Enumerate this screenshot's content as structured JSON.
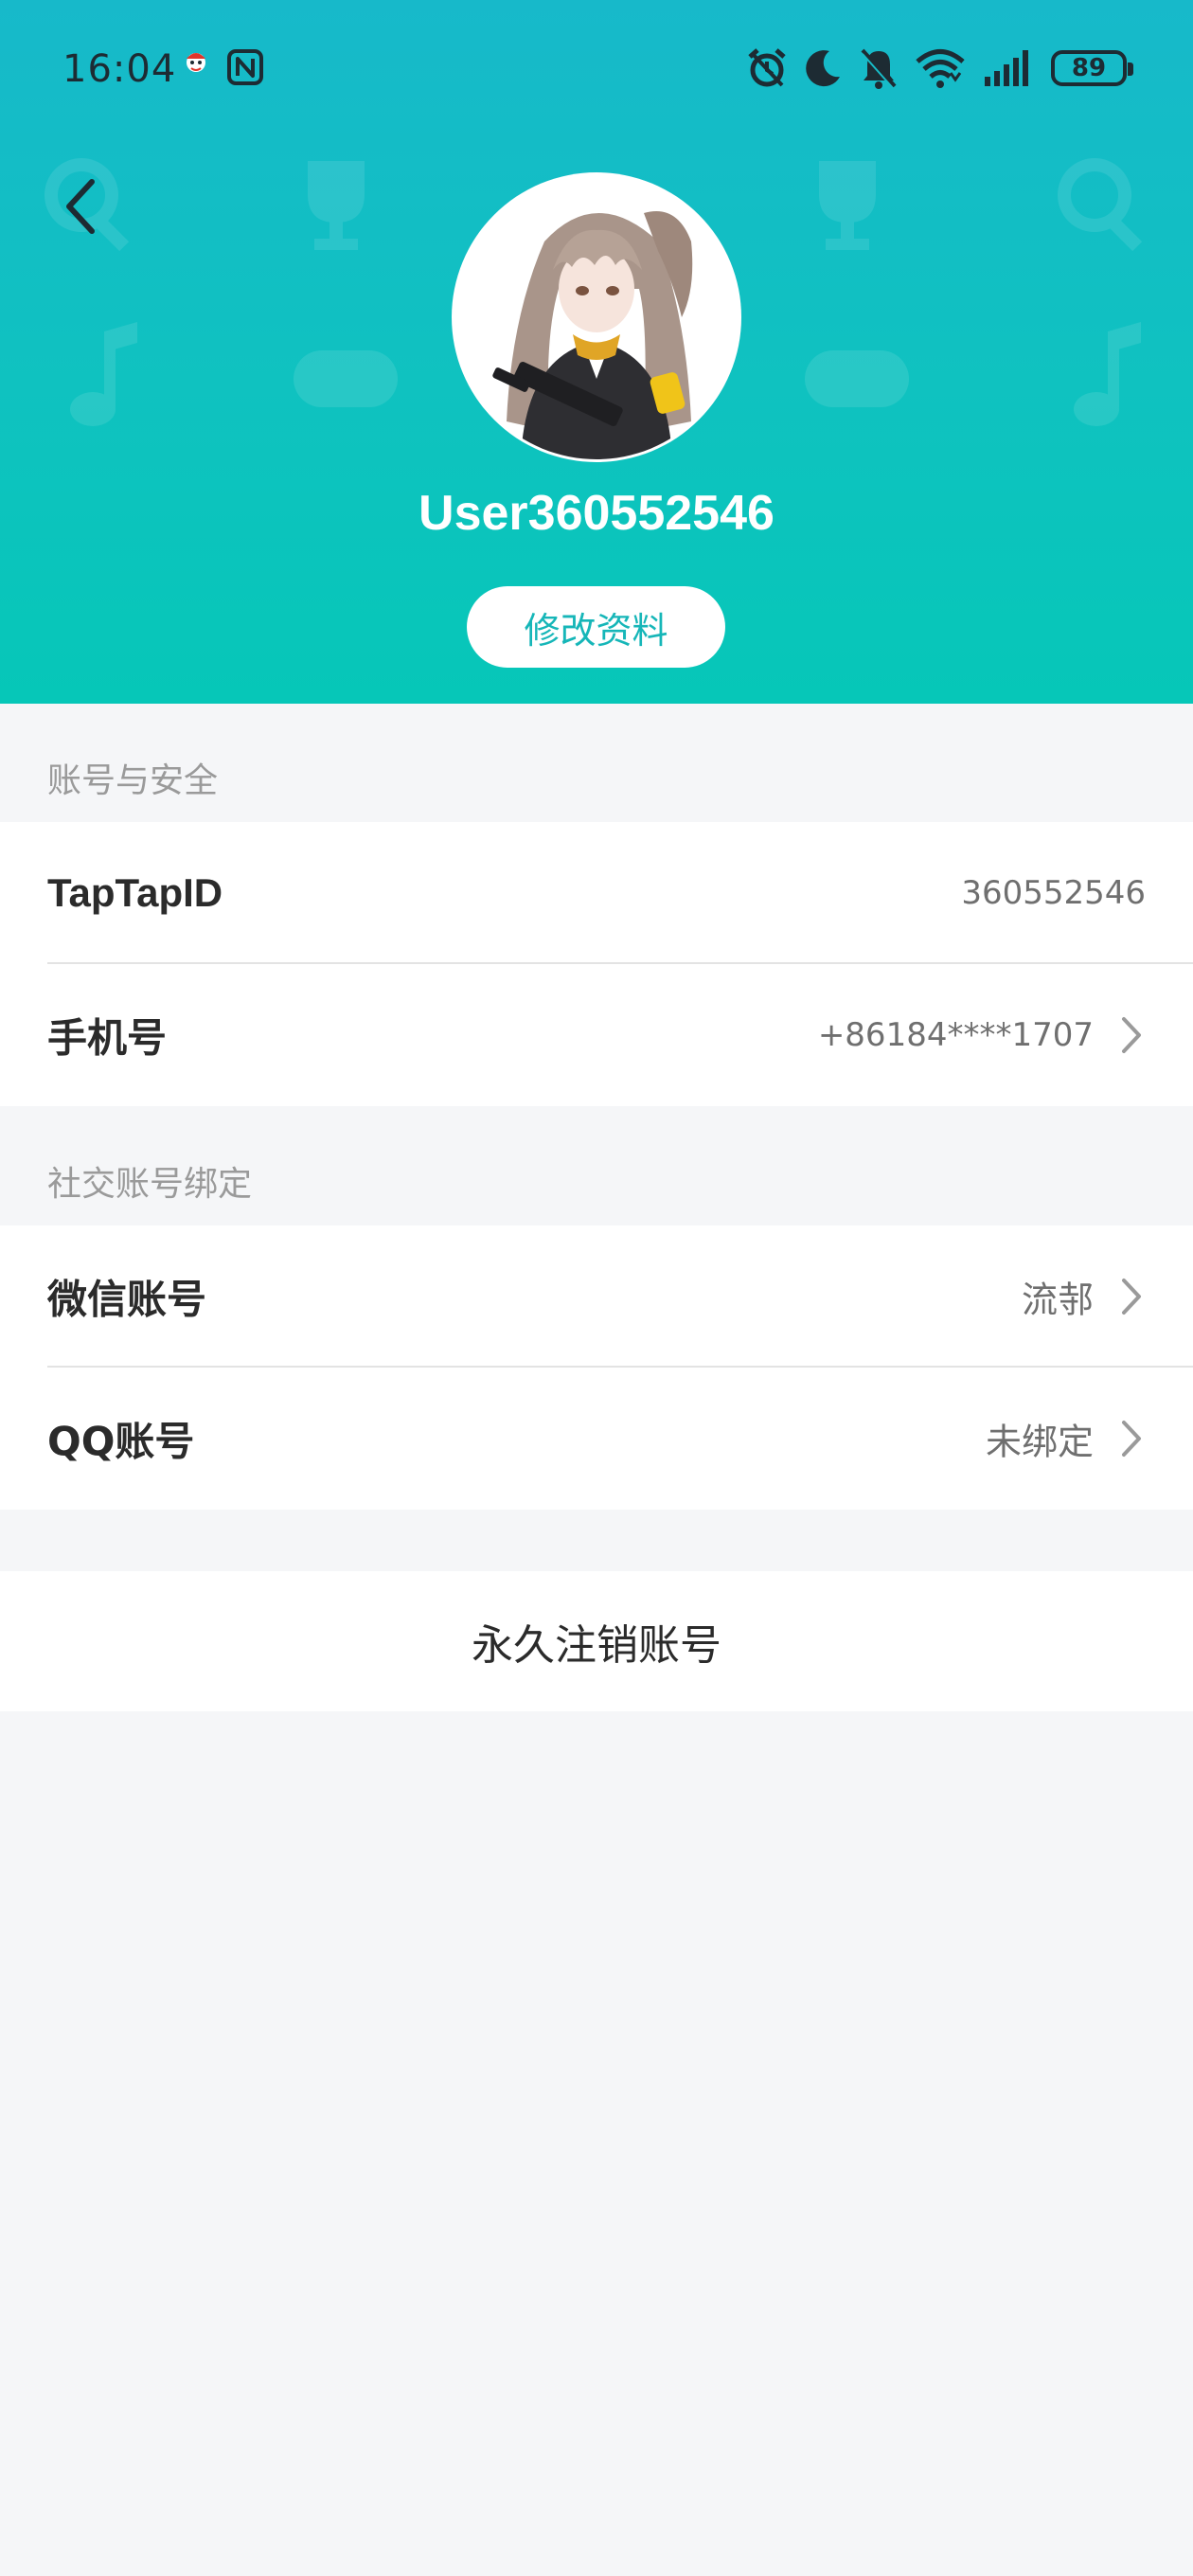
{
  "status_bar": {
    "time": "16:04",
    "battery": "89"
  },
  "profile": {
    "username": "User360552546",
    "edit_button": "修改资料"
  },
  "account_security": {
    "title": "账号与安全",
    "rows": [
      {
        "label": "TapTapID",
        "value": "360552546"
      },
      {
        "label": "手机号",
        "value": "+86184****1707"
      }
    ]
  },
  "social_binding": {
    "title": "社交账号绑定",
    "rows": [
      {
        "label": "微信账号",
        "value": "流邿"
      },
      {
        "label": "QQ账号",
        "value": "未绑定"
      }
    ]
  },
  "delete_account": {
    "label": "永久注销账号"
  },
  "colors": {
    "header_gradient_top": "#17b9ca",
    "header_gradient_bottom": "#06c7b8",
    "accent": "#16b6b8",
    "page_background": "#f5f6f8"
  },
  "icons": [
    "notification-app-icon",
    "nfc-icon",
    "alarm-icon",
    "moon-icon",
    "bell-off-icon",
    "wifi-icon",
    "signal-icon",
    "battery-icon",
    "back-arrow-icon",
    "chevron-right-icon"
  ]
}
